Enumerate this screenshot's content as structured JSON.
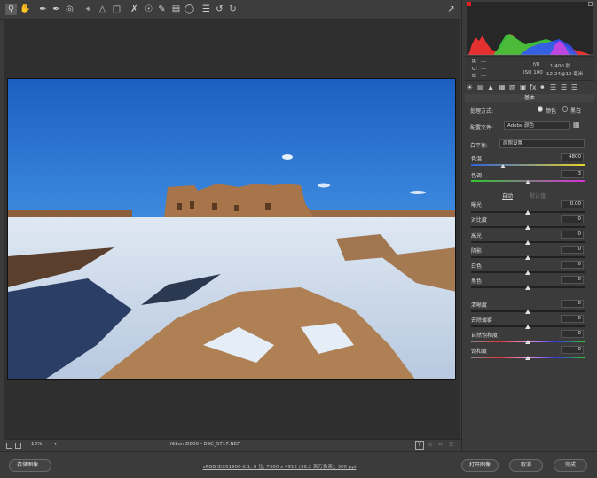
{
  "toolbar": {
    "tools": [
      "zoom-icon",
      "hand-icon",
      "white-balance-icon",
      "color-sampler-icon",
      "target-adjust-icon",
      "crop-icon",
      "straighten-icon",
      "transform-icon",
      "spot-removal-icon",
      "red-eye-icon",
      "adjustment-brush-icon",
      "graduated-filter-icon",
      "radial-filter-icon",
      "preferences-icon",
      "rotate-left-icon",
      "rotate-right-icon"
    ]
  },
  "info": {
    "r_label": "R:",
    "r_val": "---",
    "g_label": "G:",
    "g_val": "---",
    "b_label": "B:",
    "b_val": "---",
    "aperture": "f/8",
    "shutter": "1/400 秒",
    "iso": "ISO 100",
    "lens": "12-24@12 毫米"
  },
  "panel": {
    "title": "基本",
    "treatment_label": "处理方式:",
    "treatment_color": "颜色",
    "treatment_bw": "黑白",
    "profile_label": "配置文件:",
    "profile_value": "Adobe 颜色",
    "wb_label": "白平衡:",
    "wb_value": "原照设置",
    "temp_label": "色温",
    "temp_value": "4800",
    "tint_label": "色调",
    "tint_value": "-3",
    "auto": "自动",
    "default": "默认值",
    "sliders": [
      {
        "label": "曝光",
        "value": "0.00"
      },
      {
        "label": "对比度",
        "value": "0"
      },
      {
        "label": "高光",
        "value": "0"
      },
      {
        "label": "阴影",
        "value": "0"
      },
      {
        "label": "白色",
        "value": "0"
      },
      {
        "label": "黑色",
        "value": "0"
      },
      {
        "label": "清晰度",
        "value": "0"
      },
      {
        "label": "去除薄雾",
        "value": "0"
      },
      {
        "label": "自然饱和度",
        "value": "0"
      },
      {
        "label": "饱和度",
        "value": "0"
      }
    ]
  },
  "bottom": {
    "zoom": "13%",
    "filename": "Nikon D800 - DSC_5717.NEF",
    "footer_info": "sRGB IEC61966-2.1; 8 位; 7360 x 4912 (36.2 百万像素); 300 ppi",
    "save_label": "存储图像...",
    "open_label": "打开图像",
    "cancel_label": "取消",
    "done_label": "完成"
  },
  "colors": {
    "accent": "#e02020",
    "panel_bg": "#3b3b3b"
  }
}
